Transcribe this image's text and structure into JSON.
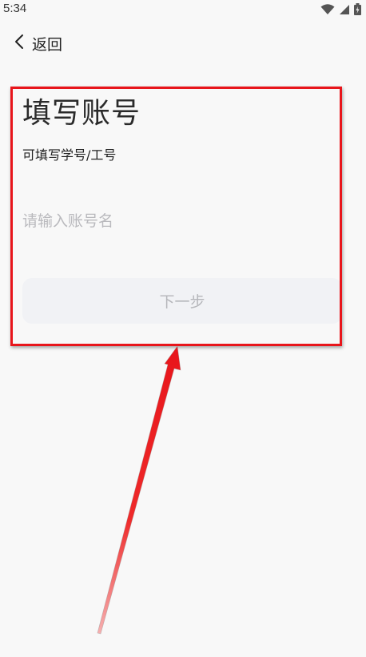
{
  "status_bar": {
    "time": "5:34",
    "icons": [
      "wifi-icon",
      "signal-icon",
      "battery-icon"
    ]
  },
  "nav": {
    "back_label": "返回",
    "back_icon": "chevron-left-icon"
  },
  "form": {
    "title": "填写账号",
    "hint": "可填写学号/工号",
    "account_placeholder": "请输入账号名",
    "account_value": "",
    "next_label": "下一步"
  },
  "colors": {
    "background": "#f8f8f8",
    "button_bg": "#f1f2f5",
    "button_text": "#b5b6ba",
    "placeholder": "#b9b9bd",
    "annotation_red": "#e8151b"
  }
}
